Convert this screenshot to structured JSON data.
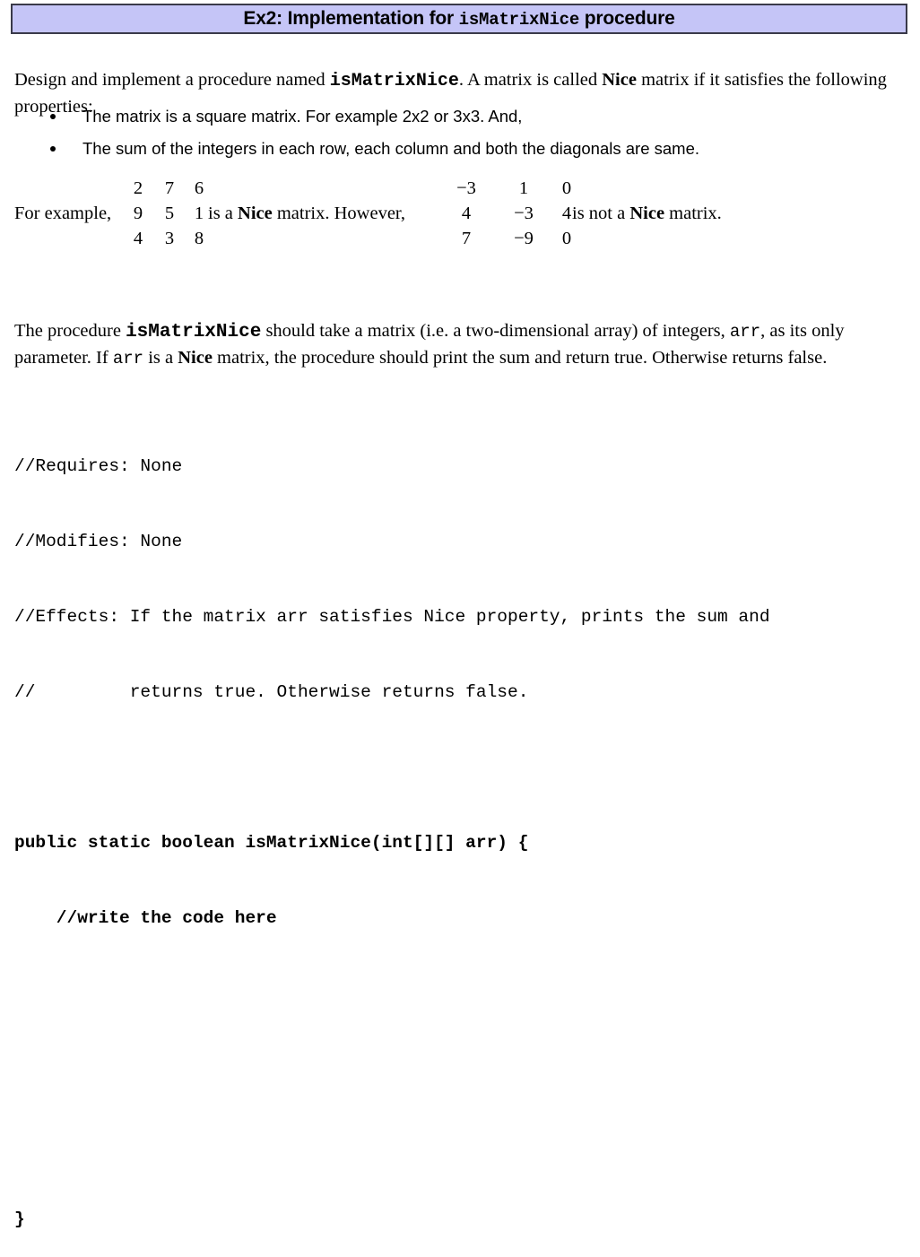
{
  "header": {
    "title_prefix": "Ex2: Implementation for ",
    "title_code": "isMatrixNice",
    "title_suffix": " procedure",
    "background_color": "#c5c5f7",
    "border_color": "#3a3a4a"
  },
  "intro": {
    "part1": "Design and implement a procedure named ",
    "code": "isMatrixNice",
    "part2": ". A matrix is called ",
    "emphasis": "Nice",
    "part3": " matrix if it satisfies the following properties:"
  },
  "bullets": [
    {
      "text": "The matrix is a square matrix. For example 2x2 or 3x3. And,"
    },
    {
      "text": "The sum of the integers in each row, each column and both the diagonals are same."
    }
  ],
  "example": {
    "lead_in": "For example,",
    "matrix1": [
      [
        "2",
        "7",
        "6"
      ],
      [
        "9",
        "5",
        "1"
      ],
      [
        "4",
        "3",
        "8"
      ]
    ],
    "matrix2": [
      [
        "−3",
        "1",
        "0"
      ],
      [
        "4",
        "−3",
        "4"
      ],
      [
        "7",
        "−9",
        "0"
      ]
    ],
    "after_matrix1_pre": "is a ",
    "after_matrix1_emph": "Nice",
    "after_matrix1_post": " matrix. However,",
    "after_matrix2_pre": "is not a ",
    "after_matrix2_emph": "Nice",
    "after_matrix2_post": " matrix."
  },
  "para2": {
    "part1": "The procedure ",
    "code1": "isMatrixNice",
    "part2": " should take a matrix (i.e. a two-dimensional array) of integers, ",
    "code2": "arr",
    "part3": ", as its only parameter. If ",
    "code3": "arr",
    "part4": " is a ",
    "emphasis": "Nice",
    "part5": " matrix, the procedure should print the sum and return true. Otherwise returns false."
  },
  "code": {
    "lines": [
      {
        "text": "//Requires: None",
        "bold": false
      },
      {
        "text": "//Modifies: None",
        "bold": false
      },
      {
        "text": "//Effects: If the matrix arr satisfies Nice property, prints the sum and",
        "bold": false
      },
      {
        "text": "//         returns true. Otherwise returns false.",
        "bold": false
      },
      {
        "text": "",
        "bold": false
      },
      {
        "text": "public static boolean isMatrixNice(int[][] arr) {",
        "bold": true
      },
      {
        "text": "    //write the code here",
        "bold": true
      },
      {
        "text": "",
        "bold": false
      },
      {
        "text": "",
        "bold": false
      },
      {
        "text": "",
        "bold": false
      },
      {
        "text": "}",
        "bold": true
      }
    ]
  }
}
